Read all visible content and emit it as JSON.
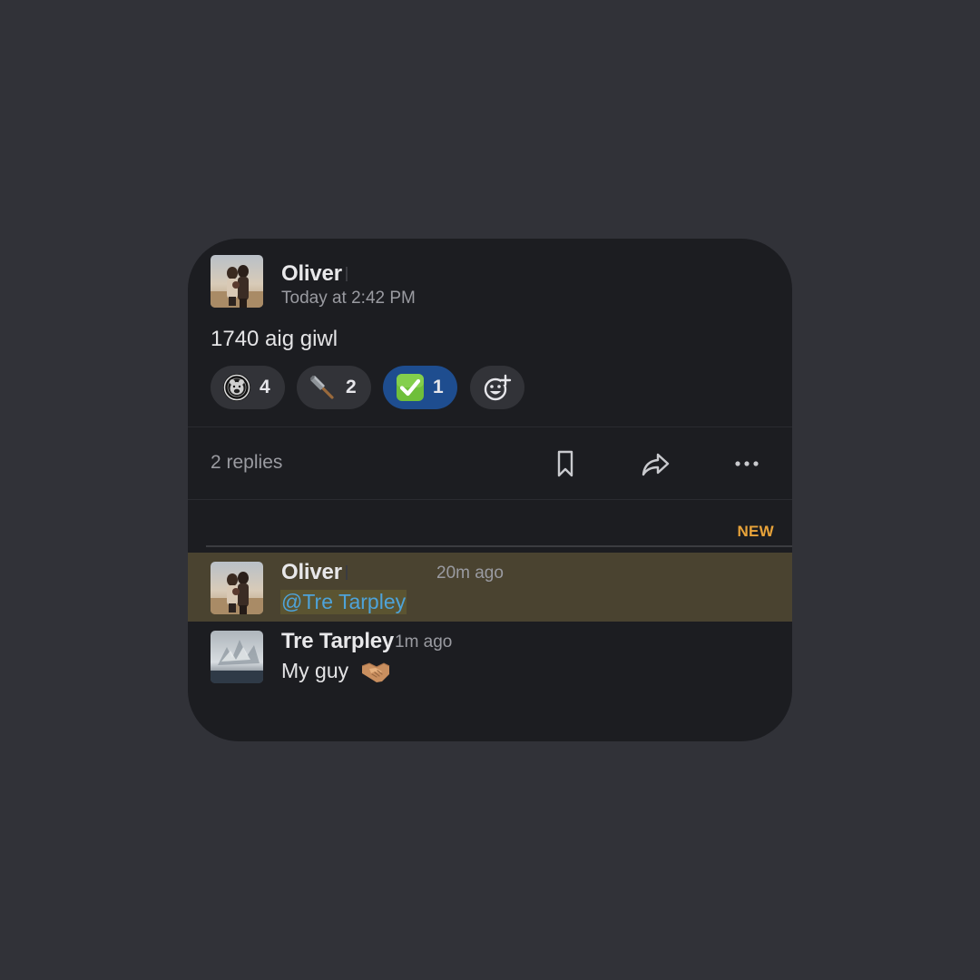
{
  "post": {
    "author": "Oliver",
    "timestamp": "Today at 2:42 PM",
    "message": "1740 aig giwl",
    "reactions": [
      {
        "emoji": "bear-logo-emoji",
        "count": "4",
        "selected": false
      },
      {
        "emoji": "hammer-emoji",
        "count": "2",
        "selected": false
      },
      {
        "emoji": "white-check-mark-emoji",
        "count": "1",
        "selected": true
      }
    ],
    "add_reaction_icon": "add-reaction-icon"
  },
  "thread_bar": {
    "replies_label": "2 replies",
    "icons": [
      "bookmark-icon",
      "share-icon",
      "more-icon"
    ]
  },
  "new_divider": {
    "label": "NEW",
    "color": "#e8a33a"
  },
  "replies": [
    {
      "author": "Oliver",
      "time": "20m ago",
      "mention": "@Tre Tarpley",
      "highlighted": true
    },
    {
      "author": "Tre Tarpley",
      "time": "1m ago",
      "text": "My guy",
      "emoji": "handshake-emoji"
    }
  ],
  "colors": {
    "background": "#313238",
    "card": "#1c1d21",
    "selected_reaction": "#1e4d8f",
    "highlight": "#4a4330",
    "mention": "#4ea3d9"
  }
}
